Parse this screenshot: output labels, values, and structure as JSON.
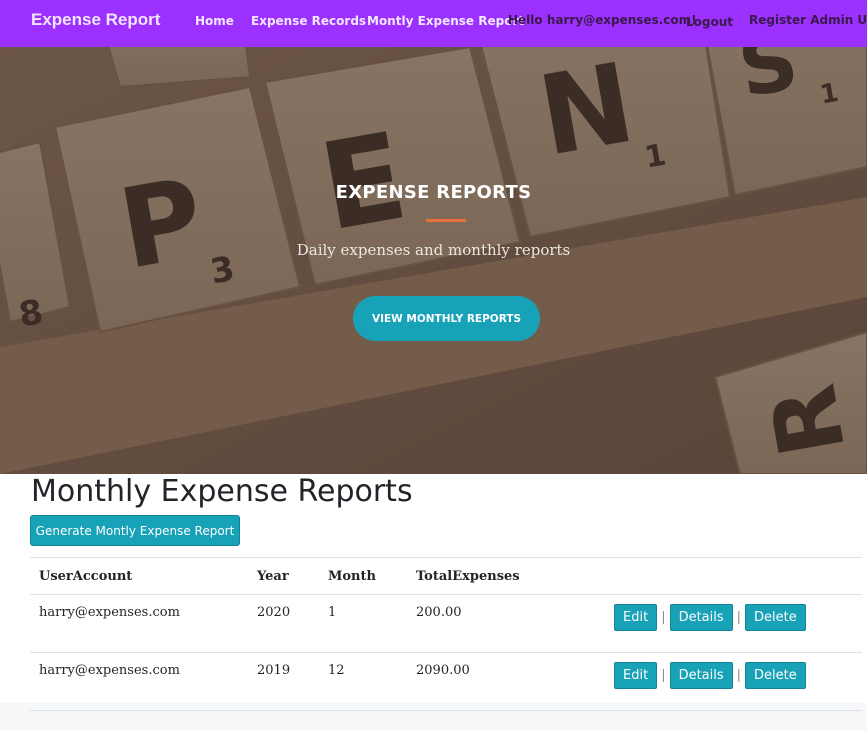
{
  "nav": {
    "brand": "Expense Report",
    "home": "Home",
    "records": "Expense Records",
    "monthly": "Montly Expense Report",
    "greeting": "Hello harry@expenses.com!",
    "logout": "Logout",
    "register": "Register Admin User"
  },
  "hero": {
    "title": "EXPENSE REPORTS",
    "subtitle": "Daily expenses and monthly reports",
    "button": "VIEW MONTHLY REPORTS"
  },
  "main": {
    "title": "Monthly Expense Reports",
    "generate_button": "Generate Montly Expense Report",
    "columns": [
      "UserAccount",
      "Year",
      "Month",
      "TotalExpenses"
    ],
    "rows": [
      {
        "user": "harry@expenses.com",
        "year": "2020",
        "month": "1",
        "total": "200.00"
      },
      {
        "user": "harry@expenses.com",
        "year": "2019",
        "month": "12",
        "total": "2090.00"
      }
    ],
    "actions": {
      "edit": "Edit",
      "details": "Details",
      "delete": "Delete",
      "separator": "|"
    }
  },
  "colors": {
    "navbar": "#9b30ff",
    "accent": "#17a2b8",
    "rule": "#e8703a"
  }
}
